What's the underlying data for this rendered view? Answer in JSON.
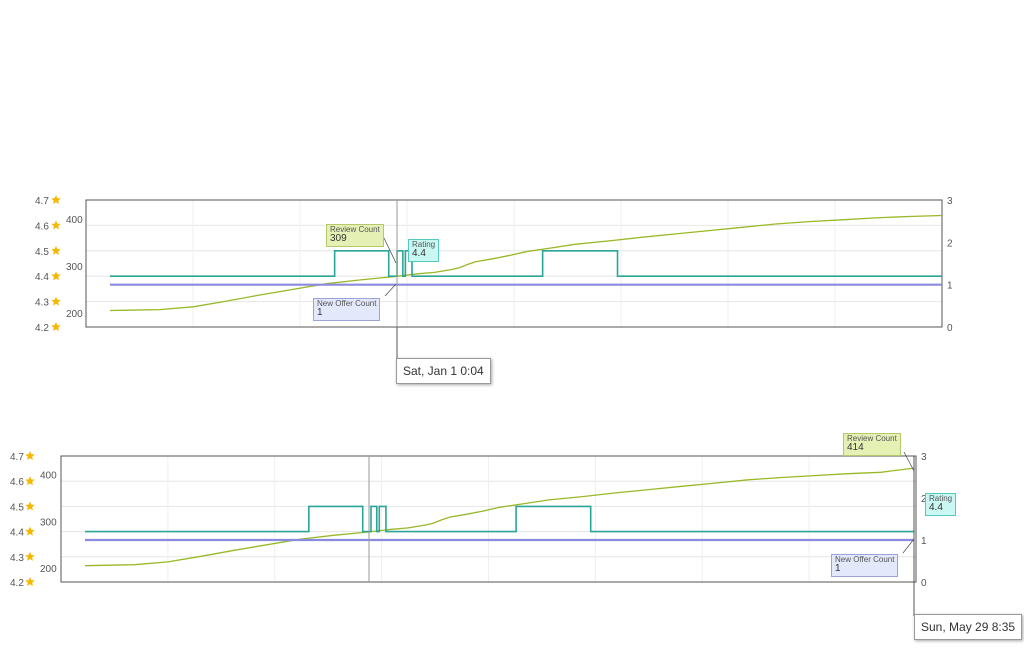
{
  "colors": {
    "review": "#99b827",
    "rating": "#2aa597",
    "offer": "#8a8ae0",
    "star": "#f5b800",
    "grid": "#e6e6e6",
    "axis_text": "#555555"
  },
  "left_axis_star_ticks": [
    "4.7",
    "4.6",
    "4.5",
    "4.4",
    "4.3",
    "4.2"
  ],
  "left_axis_review_ticks": [
    "400",
    "300",
    "200"
  ],
  "right_axis_ticks": [
    "3",
    "2",
    "1",
    "0"
  ],
  "charts": [
    {
      "tooltips": {
        "review": {
          "title": "Review Count",
          "value": "309"
        },
        "rating": {
          "title": "Rating",
          "value": "4.4"
        },
        "offer": {
          "title": "New Offer Count",
          "value": "1"
        }
      },
      "date_label": "Sat, Jan 1 0:04"
    },
    {
      "tooltips": {
        "review": {
          "title": "Review Count",
          "value": "414"
        },
        "rating": {
          "title": "Rating",
          "value": "4.4"
        },
        "offer": {
          "title": "New Offer Count",
          "value": "1"
        }
      },
      "date_label": "Sun, May 29 8:35"
    }
  ],
  "chart_data": [
    {
      "type": "line",
      "x_range": [
        0,
        100
      ],
      "series": [
        {
          "name": "Review Count",
          "axis": "reviews",
          "ylim": [
            170,
            440
          ],
          "points": [
            [
              0,
              205
            ],
            [
              6,
              207
            ],
            [
              10,
              213
            ],
            [
              14,
              225
            ],
            [
              18,
              238
            ],
            [
              22,
              250
            ],
            [
              26,
              262
            ],
            [
              30,
              270
            ],
            [
              34,
              277
            ],
            [
              37,
              283
            ],
            [
              39,
              286
            ],
            [
              41,
              292
            ],
            [
              42,
              296
            ],
            [
              43,
              303
            ],
            [
              44,
              309
            ],
            [
              46,
              315
            ],
            [
              48,
              322
            ],
            [
              50,
              330
            ],
            [
              53,
              338
            ],
            [
              56,
              346
            ],
            [
              60,
              353
            ],
            [
              64,
              361
            ],
            [
              68,
              368
            ],
            [
              72,
              375
            ],
            [
              76,
              382
            ],
            [
              80,
              389
            ],
            [
              84,
              394
            ],
            [
              88,
              398
            ],
            [
              92,
              402
            ],
            [
              96,
              405
            ],
            [
              100,
              407
            ]
          ]
        },
        {
          "name": "Rating",
          "axis": "stars",
          "ylim": [
            4.2,
            4.7
          ],
          "steps": [
            [
              0,
              4.4
            ],
            [
              27,
              4.5
            ],
            [
              33.5,
              4.4
            ],
            [
              34.5,
              4.5
            ],
            [
              35.2,
              4.4
            ],
            [
              35.5,
              4.5
            ],
            [
              36.3,
              4.4
            ],
            [
              52,
              4.5
            ],
            [
              61,
              4.4
            ],
            [
              100,
              4.4
            ]
          ]
        },
        {
          "name": "New Offer Count",
          "axis": "count",
          "ylim": [
            0,
            3
          ],
          "points": [
            [
              0,
              1
            ],
            [
              100,
              1
            ]
          ]
        }
      ],
      "cursor_x": 34
    },
    {
      "type": "line",
      "x_range": [
        0,
        100
      ],
      "series": [
        {
          "name": "Review Count",
          "axis": "reviews",
          "ylim": [
            170,
            440
          ],
          "points": [
            [
              0,
              205
            ],
            [
              6,
              207
            ],
            [
              10,
              213
            ],
            [
              14,
              225
            ],
            [
              18,
              238
            ],
            [
              22,
              250
            ],
            [
              26,
              262
            ],
            [
              30,
              270
            ],
            [
              34,
              277
            ],
            [
              37,
              283
            ],
            [
              39,
              286
            ],
            [
              41,
              292
            ],
            [
              42,
              296
            ],
            [
              43,
              303
            ],
            [
              44,
              309
            ],
            [
              46,
              315
            ],
            [
              48,
              322
            ],
            [
              50,
              330
            ],
            [
              53,
              338
            ],
            [
              56,
              346
            ],
            [
              60,
              353
            ],
            [
              64,
              361
            ],
            [
              68,
              368
            ],
            [
              72,
              375
            ],
            [
              76,
              382
            ],
            [
              80,
              389
            ],
            [
              84,
              394
            ],
            [
              88,
              398
            ],
            [
              92,
              402
            ],
            [
              96,
              405
            ],
            [
              100,
              414
            ]
          ]
        },
        {
          "name": "Rating",
          "axis": "stars",
          "ylim": [
            4.2,
            4.7
          ],
          "steps": [
            [
              0,
              4.4
            ],
            [
              27,
              4.5
            ],
            [
              33.5,
              4.4
            ],
            [
              34.5,
              4.5
            ],
            [
              35.2,
              4.4
            ],
            [
              35.5,
              4.5
            ],
            [
              36.3,
              4.4
            ],
            [
              52,
              4.5
            ],
            [
              61,
              4.4
            ],
            [
              100,
              4.4
            ]
          ]
        },
        {
          "name": "New Offer Count",
          "axis": "count",
          "ylim": [
            0,
            3
          ],
          "points": [
            [
              0,
              1
            ],
            [
              100,
              1
            ]
          ]
        }
      ],
      "cursor_x": 34
    }
  ]
}
